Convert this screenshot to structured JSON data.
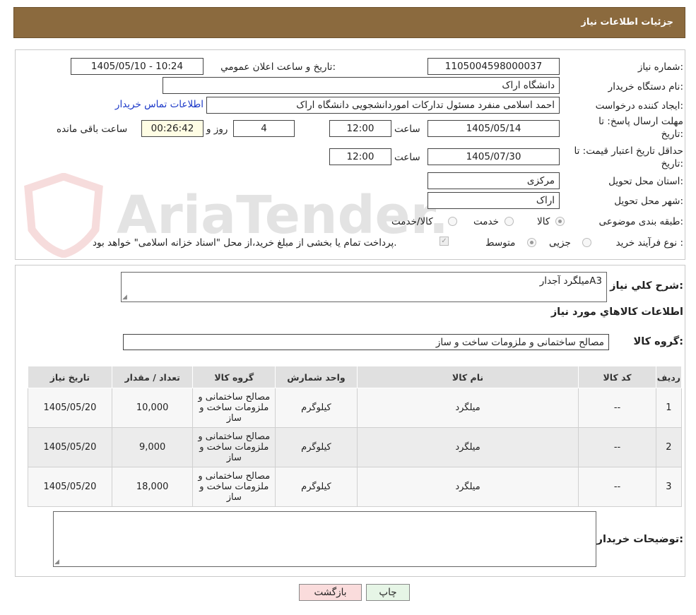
{
  "header": {
    "title": "جزئیات اطلاعات نیاز"
  },
  "form": {
    "need_no_label": "شماره نیاز:",
    "need_no": "1105004598000037",
    "announce_label": "تاریخ و ساعت اعلان عمومي:",
    "announce_value": "1405/05/10 - 10:24",
    "buyer_label": "نام دستگاه خریدار:",
    "buyer_value": "دانشگاه اراک",
    "creator_label": "ایجاد کننده درخواست:",
    "creator_value": "احمد  اسلامی منفرد مسئول تدارکات اموردانشجویی دانشگاه اراک",
    "contact_link": "اطلاعات تماس خریدار",
    "deadline_label_1": "مهلت ارسال پاسخ: تا",
    "deadline_label_2": "تاریخ:",
    "deadline_date": "1405/05/14",
    "time_label": "ساعت",
    "deadline_time": "12:00",
    "days_value": "4",
    "days_label": "روز و",
    "remaining_value": "00:26:42",
    "remaining_label": "ساعت باقی مانده",
    "validity_label_1": "حداقل تاریخ اعتبار قیمت: تا",
    "validity_label_2": "تاریخ:",
    "validity_date": "1405/07/30",
    "validity_time": "12:00",
    "province_label": "استان محل تحویل:",
    "province_value": "مرکزی",
    "city_label": "شهر محل تحویل:",
    "city_value": "اراک",
    "category_label": "طبقه بندی موضوعی:",
    "category_options": [
      "کالا",
      "خدمت",
      "کالا/خدمت"
    ],
    "process_label": "نوع فرآیند خرید :",
    "process_options": [
      "جزیی",
      "متوسط"
    ],
    "payment_note": "پرداخت تمام یا بخشی از مبلغ خرید،از محل \"اسناد خزانه اسلامی\" خواهد بود."
  },
  "details": {
    "desc_label": "شرح كلي نياز:",
    "desc_value": "میلگرد آجدارA3",
    "goods_title": "اطلاعات كالاهاي مورد نياز",
    "group_label": "گروه کالا:",
    "group_value": "مصالح ساختمانی و ملزومات ساخت و ساز",
    "columns": [
      "ردیف",
      "کد کالا",
      "نام کالا",
      "واحد شمارش",
      "گروه کالا",
      "تعداد / مقدار",
      "تاریخ نیاز"
    ],
    "rows": [
      {
        "idx": "1",
        "code": "--",
        "name": "میلگرد",
        "unit": "کیلوگرم",
        "group": "مصالح ساختمانی و ملزومات ساخت و ساز",
        "qty": "10,000",
        "date": "1405/05/20"
      },
      {
        "idx": "2",
        "code": "--",
        "name": "میلگرد",
        "unit": "کیلوگرم",
        "group": "مصالح ساختمانی و ملزومات ساخت و ساز",
        "qty": "9,000",
        "date": "1405/05/20"
      },
      {
        "idx": "3",
        "code": "--",
        "name": "میلگرد",
        "unit": "کیلوگرم",
        "group": "مصالح ساختمانی و ملزومات ساخت و ساز",
        "qty": "18,000",
        "date": "1405/05/20"
      }
    ],
    "notes_label": "توضیحات خریدار:"
  },
  "buttons": {
    "print": "چاپ",
    "back": "بازگشت"
  },
  "watermark": {
    "text": "AriaTender.neT"
  },
  "colors": {
    "header": "#8b6a3e",
    "link": "#1a37c8",
    "back_button": "#fadcdc",
    "print_button": "#e6f5e6"
  }
}
